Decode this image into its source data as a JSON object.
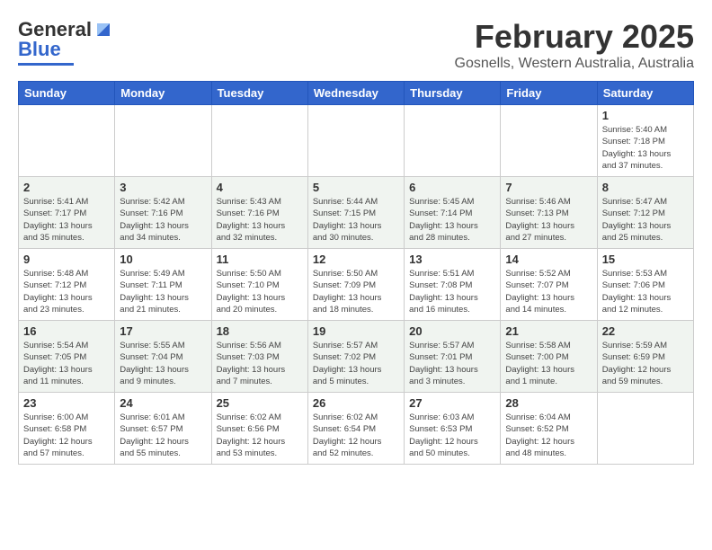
{
  "header": {
    "logo_general": "General",
    "logo_blue": "Blue",
    "title": "February 2025",
    "subtitle": "Gosnells, Western Australia, Australia"
  },
  "days_of_week": [
    "Sunday",
    "Monday",
    "Tuesday",
    "Wednesday",
    "Thursday",
    "Friday",
    "Saturday"
  ],
  "weeks": [
    [
      {
        "day": "",
        "info": ""
      },
      {
        "day": "",
        "info": ""
      },
      {
        "day": "",
        "info": ""
      },
      {
        "day": "",
        "info": ""
      },
      {
        "day": "",
        "info": ""
      },
      {
        "day": "",
        "info": ""
      },
      {
        "day": "1",
        "info": "Sunrise: 5:40 AM\nSunset: 7:18 PM\nDaylight: 13 hours\nand 37 minutes."
      }
    ],
    [
      {
        "day": "2",
        "info": "Sunrise: 5:41 AM\nSunset: 7:17 PM\nDaylight: 13 hours\nand 35 minutes."
      },
      {
        "day": "3",
        "info": "Sunrise: 5:42 AM\nSunset: 7:16 PM\nDaylight: 13 hours\nand 34 minutes."
      },
      {
        "day": "4",
        "info": "Sunrise: 5:43 AM\nSunset: 7:16 PM\nDaylight: 13 hours\nand 32 minutes."
      },
      {
        "day": "5",
        "info": "Sunrise: 5:44 AM\nSunset: 7:15 PM\nDaylight: 13 hours\nand 30 minutes."
      },
      {
        "day": "6",
        "info": "Sunrise: 5:45 AM\nSunset: 7:14 PM\nDaylight: 13 hours\nand 28 minutes."
      },
      {
        "day": "7",
        "info": "Sunrise: 5:46 AM\nSunset: 7:13 PM\nDaylight: 13 hours\nand 27 minutes."
      },
      {
        "day": "8",
        "info": "Sunrise: 5:47 AM\nSunset: 7:12 PM\nDaylight: 13 hours\nand 25 minutes."
      }
    ],
    [
      {
        "day": "9",
        "info": "Sunrise: 5:48 AM\nSunset: 7:12 PM\nDaylight: 13 hours\nand 23 minutes."
      },
      {
        "day": "10",
        "info": "Sunrise: 5:49 AM\nSunset: 7:11 PM\nDaylight: 13 hours\nand 21 minutes."
      },
      {
        "day": "11",
        "info": "Sunrise: 5:50 AM\nSunset: 7:10 PM\nDaylight: 13 hours\nand 20 minutes."
      },
      {
        "day": "12",
        "info": "Sunrise: 5:50 AM\nSunset: 7:09 PM\nDaylight: 13 hours\nand 18 minutes."
      },
      {
        "day": "13",
        "info": "Sunrise: 5:51 AM\nSunset: 7:08 PM\nDaylight: 13 hours\nand 16 minutes."
      },
      {
        "day": "14",
        "info": "Sunrise: 5:52 AM\nSunset: 7:07 PM\nDaylight: 13 hours\nand 14 minutes."
      },
      {
        "day": "15",
        "info": "Sunrise: 5:53 AM\nSunset: 7:06 PM\nDaylight: 13 hours\nand 12 minutes."
      }
    ],
    [
      {
        "day": "16",
        "info": "Sunrise: 5:54 AM\nSunset: 7:05 PM\nDaylight: 13 hours\nand 11 minutes."
      },
      {
        "day": "17",
        "info": "Sunrise: 5:55 AM\nSunset: 7:04 PM\nDaylight: 13 hours\nand 9 minutes."
      },
      {
        "day": "18",
        "info": "Sunrise: 5:56 AM\nSunset: 7:03 PM\nDaylight: 13 hours\nand 7 minutes."
      },
      {
        "day": "19",
        "info": "Sunrise: 5:57 AM\nSunset: 7:02 PM\nDaylight: 13 hours\nand 5 minutes."
      },
      {
        "day": "20",
        "info": "Sunrise: 5:57 AM\nSunset: 7:01 PM\nDaylight: 13 hours\nand 3 minutes."
      },
      {
        "day": "21",
        "info": "Sunrise: 5:58 AM\nSunset: 7:00 PM\nDaylight: 13 hours\nand 1 minute."
      },
      {
        "day": "22",
        "info": "Sunrise: 5:59 AM\nSunset: 6:59 PM\nDaylight: 12 hours\nand 59 minutes."
      }
    ],
    [
      {
        "day": "23",
        "info": "Sunrise: 6:00 AM\nSunset: 6:58 PM\nDaylight: 12 hours\nand 57 minutes."
      },
      {
        "day": "24",
        "info": "Sunrise: 6:01 AM\nSunset: 6:57 PM\nDaylight: 12 hours\nand 55 minutes."
      },
      {
        "day": "25",
        "info": "Sunrise: 6:02 AM\nSunset: 6:56 PM\nDaylight: 12 hours\nand 53 minutes."
      },
      {
        "day": "26",
        "info": "Sunrise: 6:02 AM\nSunset: 6:54 PM\nDaylight: 12 hours\nand 52 minutes."
      },
      {
        "day": "27",
        "info": "Sunrise: 6:03 AM\nSunset: 6:53 PM\nDaylight: 12 hours\nand 50 minutes."
      },
      {
        "day": "28",
        "info": "Sunrise: 6:04 AM\nSunset: 6:52 PM\nDaylight: 12 hours\nand 48 minutes."
      },
      {
        "day": "",
        "info": ""
      }
    ]
  ]
}
